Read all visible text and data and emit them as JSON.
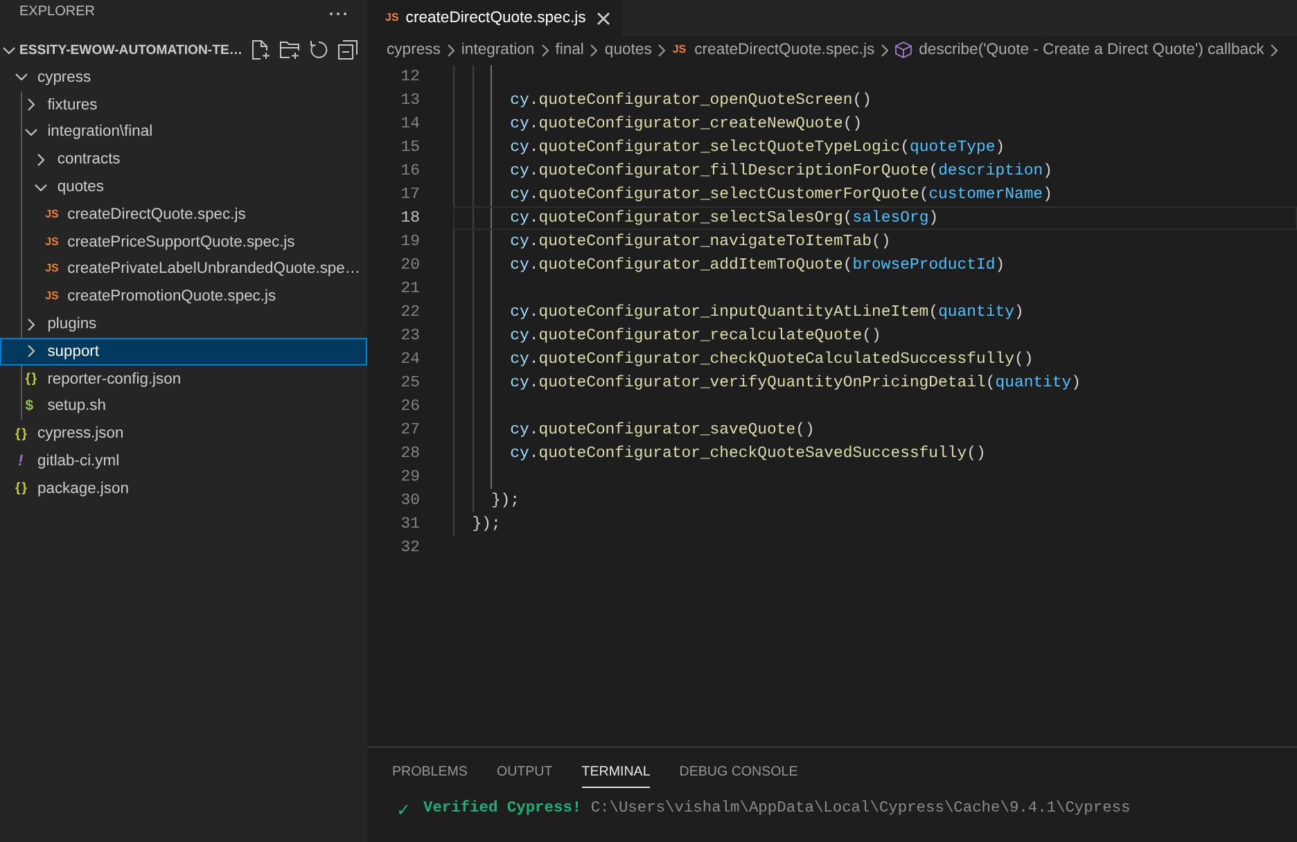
{
  "explorer": {
    "title": "EXPLORER",
    "root": {
      "label": "ESSITY-EWOW-AUTOMATION-TE…",
      "expanded": true,
      "children": [
        {
          "kind": "folder",
          "label": "cypress",
          "expanded": true,
          "selected": false,
          "children": [
            {
              "kind": "folder",
              "label": "fixtures",
              "expanded": false,
              "selected": false
            },
            {
              "kind": "folder",
              "label": "integration\\final",
              "expanded": true,
              "selected": false,
              "children": [
                {
                  "kind": "folder",
                  "label": "contracts",
                  "expanded": false,
                  "selected": false
                },
                {
                  "kind": "folder",
                  "label": "quotes",
                  "expanded": true,
                  "selected": false,
                  "children": [
                    {
                      "kind": "js",
                      "icon": "JS",
                      "label": "createDirectQuote.spec.js",
                      "selected": false
                    },
                    {
                      "kind": "js",
                      "icon": "JS",
                      "label": "createPriceSupportQuote.spec.js",
                      "selected": false
                    },
                    {
                      "kind": "js",
                      "icon": "JS",
                      "label": "createPrivateLabelUnbrandedQuote.spe…",
                      "selected": false
                    },
                    {
                      "kind": "js",
                      "icon": "JS",
                      "label": "createPromotionQuote.spec.js",
                      "selected": false
                    }
                  ]
                }
              ]
            },
            {
              "kind": "folder",
              "label": "plugins",
              "expanded": false,
              "selected": false
            },
            {
              "kind": "folder",
              "label": "support",
              "expanded": false,
              "selected": true
            },
            {
              "kind": "json",
              "icon": "{}",
              "label": "reporter-config.json",
              "selected": false
            },
            {
              "kind": "shell",
              "icon": "$",
              "label": "setup.sh",
              "selected": false
            }
          ]
        },
        {
          "kind": "json",
          "icon": "{}",
          "label": "cypress.json",
          "selected": false
        },
        {
          "kind": "yaml",
          "icon": "!",
          "label": "gitlab-ci.yml",
          "selected": false
        },
        {
          "kind": "json",
          "icon": "{}",
          "label": "package.json",
          "selected": false
        }
      ]
    }
  },
  "tabs": [
    {
      "icon": "JS",
      "label": "createDirectQuote.spec.js",
      "selected": true
    }
  ],
  "breadcrumbs": [
    {
      "kind": "folder",
      "label": "cypress"
    },
    {
      "kind": "folder",
      "label": "integration"
    },
    {
      "kind": "folder",
      "label": "final"
    },
    {
      "kind": "folder",
      "label": "quotes"
    },
    {
      "kind": "file",
      "icon": "JS",
      "label": "createDirectQuote.spec.js"
    },
    {
      "kind": "symbol",
      "label": "describe('Quote - Create a Direct Quote') callback"
    }
  ],
  "editor": {
    "lines": [
      {
        "kind": "block",
        "children": [
          {
            "kind": "block",
            "children": [
              {
                "kind": "block",
                "children": [
                  {
                    "kind": "line",
                    "number": "12",
                    "active": false
                  },
                  {
                    "kind": "line",
                    "number": "13",
                    "active": false,
                    "tokens": [
                      {
                        "kind": "object",
                        "text": "cy"
                      },
                      {
                        "kind": "punct",
                        "text": "."
                      },
                      {
                        "kind": "function",
                        "text": "quoteConfigurator_openQuoteScreen"
                      },
                      {
                        "kind": "punct",
                        "text": "()"
                      }
                    ]
                  },
                  {
                    "kind": "line",
                    "number": "14",
                    "active": false,
                    "tokens": [
                      {
                        "kind": "object",
                        "text": "cy"
                      },
                      {
                        "kind": "punct",
                        "text": "."
                      },
                      {
                        "kind": "function",
                        "text": "quoteConfigurator_createNewQuote"
                      },
                      {
                        "kind": "punct",
                        "text": "()"
                      }
                    ]
                  },
                  {
                    "kind": "line",
                    "number": "15",
                    "active": false,
                    "tokens": [
                      {
                        "kind": "object",
                        "text": "cy"
                      },
                      {
                        "kind": "punct",
                        "text": "."
                      },
                      {
                        "kind": "function",
                        "text": "quoteConfigurator_selectQuoteTypeLogic"
                      },
                      {
                        "kind": "punct",
                        "text": "("
                      },
                      {
                        "kind": "param",
                        "text": "quoteType"
                      },
                      {
                        "kind": "punct",
                        "text": ")"
                      }
                    ]
                  },
                  {
                    "kind": "line",
                    "number": "16",
                    "active": false,
                    "tokens": [
                      {
                        "kind": "object",
                        "text": "cy"
                      },
                      {
                        "kind": "punct",
                        "text": "."
                      },
                      {
                        "kind": "function",
                        "text": "quoteConfigurator_fillDescriptionForQuote"
                      },
                      {
                        "kind": "punct",
                        "text": "("
                      },
                      {
                        "kind": "param",
                        "text": "description"
                      },
                      {
                        "kind": "punct",
                        "text": ")"
                      }
                    ]
                  },
                  {
                    "kind": "line",
                    "number": "17",
                    "active": false,
                    "tokens": [
                      {
                        "kind": "object",
                        "text": "cy"
                      },
                      {
                        "kind": "punct",
                        "text": "."
                      },
                      {
                        "kind": "function",
                        "text": "quoteConfigurator_selectCustomerForQuote"
                      },
                      {
                        "kind": "punct",
                        "text": "("
                      },
                      {
                        "kind": "param",
                        "text": "customerName"
                      },
                      {
                        "kind": "punct",
                        "text": ")"
                      }
                    ]
                  },
                  {
                    "kind": "line",
                    "number": "18",
                    "active": true,
                    "tokens": [
                      {
                        "kind": "object",
                        "text": "cy"
                      },
                      {
                        "kind": "punct",
                        "text": "."
                      },
                      {
                        "kind": "function",
                        "text": "quoteConfigurator_selectSalesOrg"
                      },
                      {
                        "kind": "punct",
                        "text": "("
                      },
                      {
                        "kind": "param",
                        "text": "salesOrg"
                      },
                      {
                        "kind": "punct",
                        "text": ")"
                      }
                    ]
                  },
                  {
                    "kind": "line",
                    "number": "19",
                    "active": false,
                    "tokens": [
                      {
                        "kind": "object",
                        "text": "cy"
                      },
                      {
                        "kind": "punct",
                        "text": "."
                      },
                      {
                        "kind": "function",
                        "text": "quoteConfigurator_navigateToItemTab"
                      },
                      {
                        "kind": "punct",
                        "text": "()"
                      }
                    ]
                  },
                  {
                    "kind": "line",
                    "number": "20",
                    "active": false,
                    "tokens": [
                      {
                        "kind": "object",
                        "text": "cy"
                      },
                      {
                        "kind": "punct",
                        "text": "."
                      },
                      {
                        "kind": "function",
                        "text": "quoteConfigurator_addItemToQuote"
                      },
                      {
                        "kind": "punct",
                        "text": "("
                      },
                      {
                        "kind": "param",
                        "text": "browseProductId"
                      },
                      {
                        "kind": "punct",
                        "text": ")"
                      }
                    ]
                  },
                  {
                    "kind": "line",
                    "number": "21",
                    "active": false
                  },
                  {
                    "kind": "line",
                    "number": "22",
                    "active": false,
                    "tokens": [
                      {
                        "kind": "object",
                        "text": "cy"
                      },
                      {
                        "kind": "punct",
                        "text": "."
                      },
                      {
                        "kind": "function",
                        "text": "quoteConfigurator_inputQuantityAtLineItem"
                      },
                      {
                        "kind": "punct",
                        "text": "("
                      },
                      {
                        "kind": "param",
                        "text": "quantity"
                      },
                      {
                        "kind": "punct",
                        "text": ")"
                      }
                    ]
                  },
                  {
                    "kind": "line",
                    "number": "23",
                    "active": false,
                    "tokens": [
                      {
                        "kind": "object",
                        "text": "cy"
                      },
                      {
                        "kind": "punct",
                        "text": "."
                      },
                      {
                        "kind": "function",
                        "text": "quoteConfigurator_recalculateQuote"
                      },
                      {
                        "kind": "punct",
                        "text": "()"
                      }
                    ]
                  },
                  {
                    "kind": "line",
                    "number": "24",
                    "active": false,
                    "tokens": [
                      {
                        "kind": "object",
                        "text": "cy"
                      },
                      {
                        "kind": "punct",
                        "text": "."
                      },
                      {
                        "kind": "function",
                        "text": "quoteConfigurator_checkQuoteCalculatedSuccessfully"
                      },
                      {
                        "kind": "punct",
                        "text": "()"
                      }
                    ]
                  },
                  {
                    "kind": "line",
                    "number": "25",
                    "active": false,
                    "tokens": [
                      {
                        "kind": "object",
                        "text": "cy"
                      },
                      {
                        "kind": "punct",
                        "text": "."
                      },
                      {
                        "kind": "function",
                        "text": "quoteConfigurator_verifyQuantityOnPricingDetail"
                      },
                      {
                        "kind": "punct",
                        "text": "("
                      },
                      {
                        "kind": "param",
                        "text": "quantity"
                      },
                      {
                        "kind": "punct",
                        "text": ")"
                      }
                    ]
                  },
                  {
                    "kind": "line",
                    "number": "26",
                    "active": false
                  },
                  {
                    "kind": "line",
                    "number": "27",
                    "active": false,
                    "tokens": [
                      {
                        "kind": "object",
                        "text": "cy"
                      },
                      {
                        "kind": "punct",
                        "text": "."
                      },
                      {
                        "kind": "function",
                        "text": "quoteConfigurator_saveQuote"
                      },
                      {
                        "kind": "punct",
                        "text": "()"
                      }
                    ]
                  },
                  {
                    "kind": "line",
                    "number": "28",
                    "active": false,
                    "tokens": [
                      {
                        "kind": "object",
                        "text": "cy"
                      },
                      {
                        "kind": "punct",
                        "text": "."
                      },
                      {
                        "kind": "function",
                        "text": "quoteConfigurator_checkQuoteSavedSuccessfully"
                      },
                      {
                        "kind": "punct",
                        "text": "()"
                      }
                    ]
                  },
                  {
                    "kind": "line",
                    "number": "29",
                    "active": false
                  }
                ]
              },
              {
                "kind": "line",
                "number": "30",
                "active": false,
                "tokens": [
                  {
                    "kind": "punct",
                    "text": "});"
                  }
                ]
              }
            ]
          },
          {
            "kind": "line",
            "number": "31",
            "active": false,
            "tokens": [
              {
                "kind": "punct",
                "text": "});"
              }
            ]
          }
        ]
      },
      {
        "kind": "line",
        "number": "32",
        "active": false
      }
    ]
  },
  "panel": {
    "tabs": [
      {
        "label": "PROBLEMS",
        "selected": false
      },
      {
        "label": "OUTPUT",
        "selected": false
      },
      {
        "label": "TERMINAL",
        "selected": true
      },
      {
        "label": "DEBUG CONSOLE",
        "selected": false
      }
    ],
    "terminal": [
      {
        "icon": "✓",
        "tokens": [
          {
            "kind": "success",
            "text": "Verified Cypress!"
          },
          {
            "kind": "path",
            "text": "C:\\Users\\vishalm\\AppData\\Local\\Cypress\\Cache\\9.4.1\\Cypress"
          }
        ]
      }
    ]
  }
}
